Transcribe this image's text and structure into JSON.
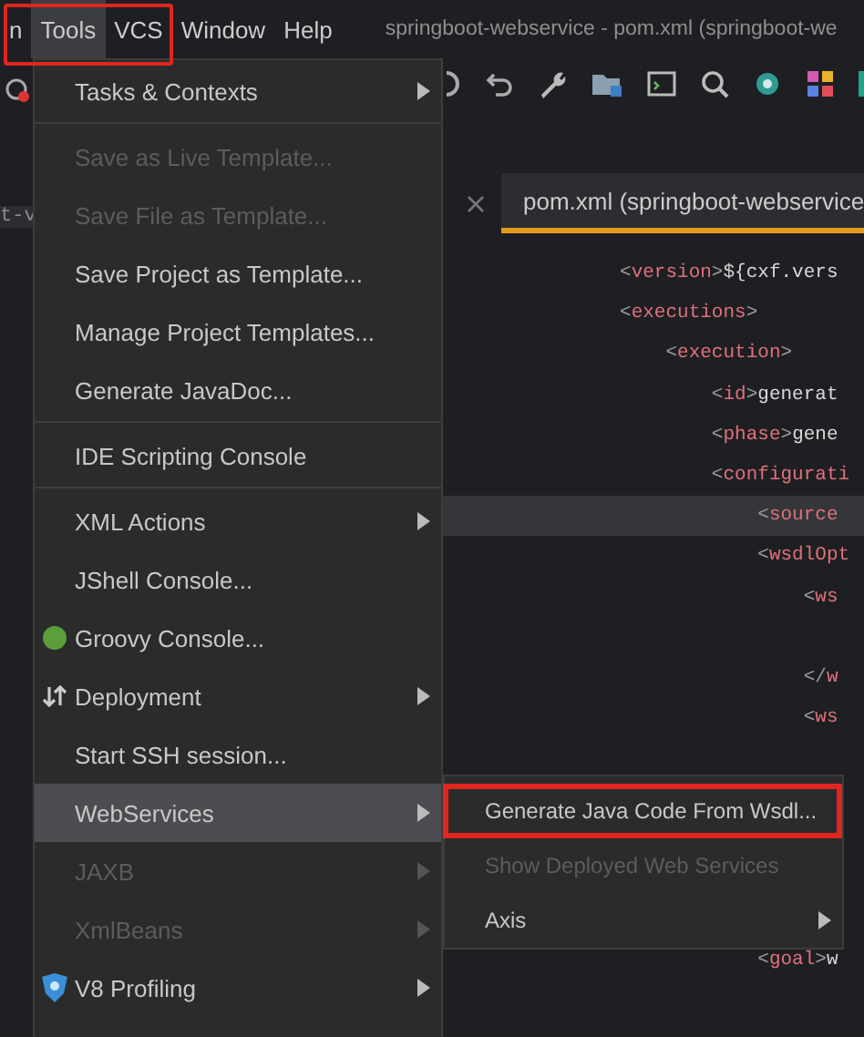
{
  "menubar": {
    "items": [
      {
        "label": "n",
        "selected": false
      },
      {
        "label": "Tools",
        "selected": true
      },
      {
        "label": "VCS",
        "selected": false
      },
      {
        "label": "Window",
        "selected": false
      },
      {
        "label": "Help",
        "selected": false
      }
    ],
    "title": "springboot-webservice - pom.xml (springboot-we"
  },
  "left_strip": {
    "text": "t-v"
  },
  "editor": {
    "tab": {
      "label": "pom.xml (springboot-webservice"
    },
    "lines": [
      {
        "kind": "code",
        "text": "<version>${cxf.vers",
        "current": false
      },
      {
        "kind": "code",
        "text": "<executions>",
        "current": false
      },
      {
        "kind": "code",
        "text": "    <execution>",
        "current": false
      },
      {
        "kind": "code",
        "text": "        <id>generat",
        "current": false
      },
      {
        "kind": "code",
        "text": "        <phase>gene",
        "current": false
      },
      {
        "kind": "code",
        "text": "        <configurati",
        "current": false
      },
      {
        "kind": "code",
        "text": "            <source",
        "current": true
      },
      {
        "kind": "code",
        "text": "            <wsdlOpt",
        "current": false
      },
      {
        "kind": "code",
        "text": "                <ws",
        "current": false
      },
      {
        "kind": "blank"
      },
      {
        "kind": "code",
        "text": "                </w",
        "current": false
      },
      {
        "kind": "code",
        "text": "                <ws",
        "current": false
      },
      {
        "kind": "blank"
      },
      {
        "kind": "blank"
      },
      {
        "kind": "blank"
      },
      {
        "kind": "blank"
      },
      {
        "kind": "blank"
      },
      {
        "kind": "code",
        "text": "            <goal>w",
        "current": false
      }
    ]
  },
  "tools_menu": {
    "items": [
      {
        "kind": "item",
        "label": "Tasks & Contexts",
        "submenu": true,
        "disabled": false,
        "selected": false
      },
      {
        "kind": "separator"
      },
      {
        "kind": "item",
        "label": "Save as Live Template...",
        "submenu": false,
        "disabled": true,
        "selected": false
      },
      {
        "kind": "item",
        "label": "Save File as Template...",
        "submenu": false,
        "disabled": true,
        "selected": false
      },
      {
        "kind": "item",
        "label": "Save Project as Template...",
        "submenu": false,
        "disabled": false,
        "selected": false
      },
      {
        "kind": "item",
        "label": "Manage Project Templates...",
        "submenu": false,
        "disabled": false,
        "selected": false
      },
      {
        "kind": "item",
        "label": "Generate JavaDoc...",
        "submenu": false,
        "disabled": false,
        "selected": false
      },
      {
        "kind": "separator"
      },
      {
        "kind": "item",
        "label": "IDE Scripting Console",
        "submenu": false,
        "disabled": false,
        "selected": false
      },
      {
        "kind": "separator"
      },
      {
        "kind": "item",
        "label": "XML Actions",
        "submenu": true,
        "disabled": false,
        "selected": false
      },
      {
        "kind": "item",
        "label": "JShell Console...",
        "submenu": false,
        "disabled": false,
        "selected": false
      },
      {
        "kind": "item",
        "label": "Groovy Console...",
        "submenu": false,
        "disabled": false,
        "selected": false
      },
      {
        "kind": "item",
        "label": "Deployment",
        "submenu": true,
        "disabled": false,
        "selected": false
      },
      {
        "kind": "item",
        "label": "Start SSH session...",
        "submenu": false,
        "disabled": false,
        "selected": false
      },
      {
        "kind": "item",
        "label": "WebServices",
        "submenu": true,
        "disabled": false,
        "selected": true
      },
      {
        "kind": "item",
        "label": "JAXB",
        "submenu": true,
        "disabled": true,
        "selected": false
      },
      {
        "kind": "item",
        "label": "XmlBeans",
        "submenu": true,
        "disabled": true,
        "selected": false
      },
      {
        "kind": "item",
        "label": "V8 Profiling",
        "submenu": true,
        "disabled": false,
        "selected": false
      }
    ]
  },
  "webservices_menu": {
    "items": [
      {
        "label": "Generate Java Code From Wsdl...",
        "submenu": false,
        "disabled": false,
        "highlighted": true
      },
      {
        "label": "Show Deployed Web Services",
        "submenu": false,
        "disabled": true,
        "highlighted": false
      },
      {
        "label": "Axis",
        "submenu": true,
        "disabled": false,
        "highlighted": false
      }
    ]
  }
}
